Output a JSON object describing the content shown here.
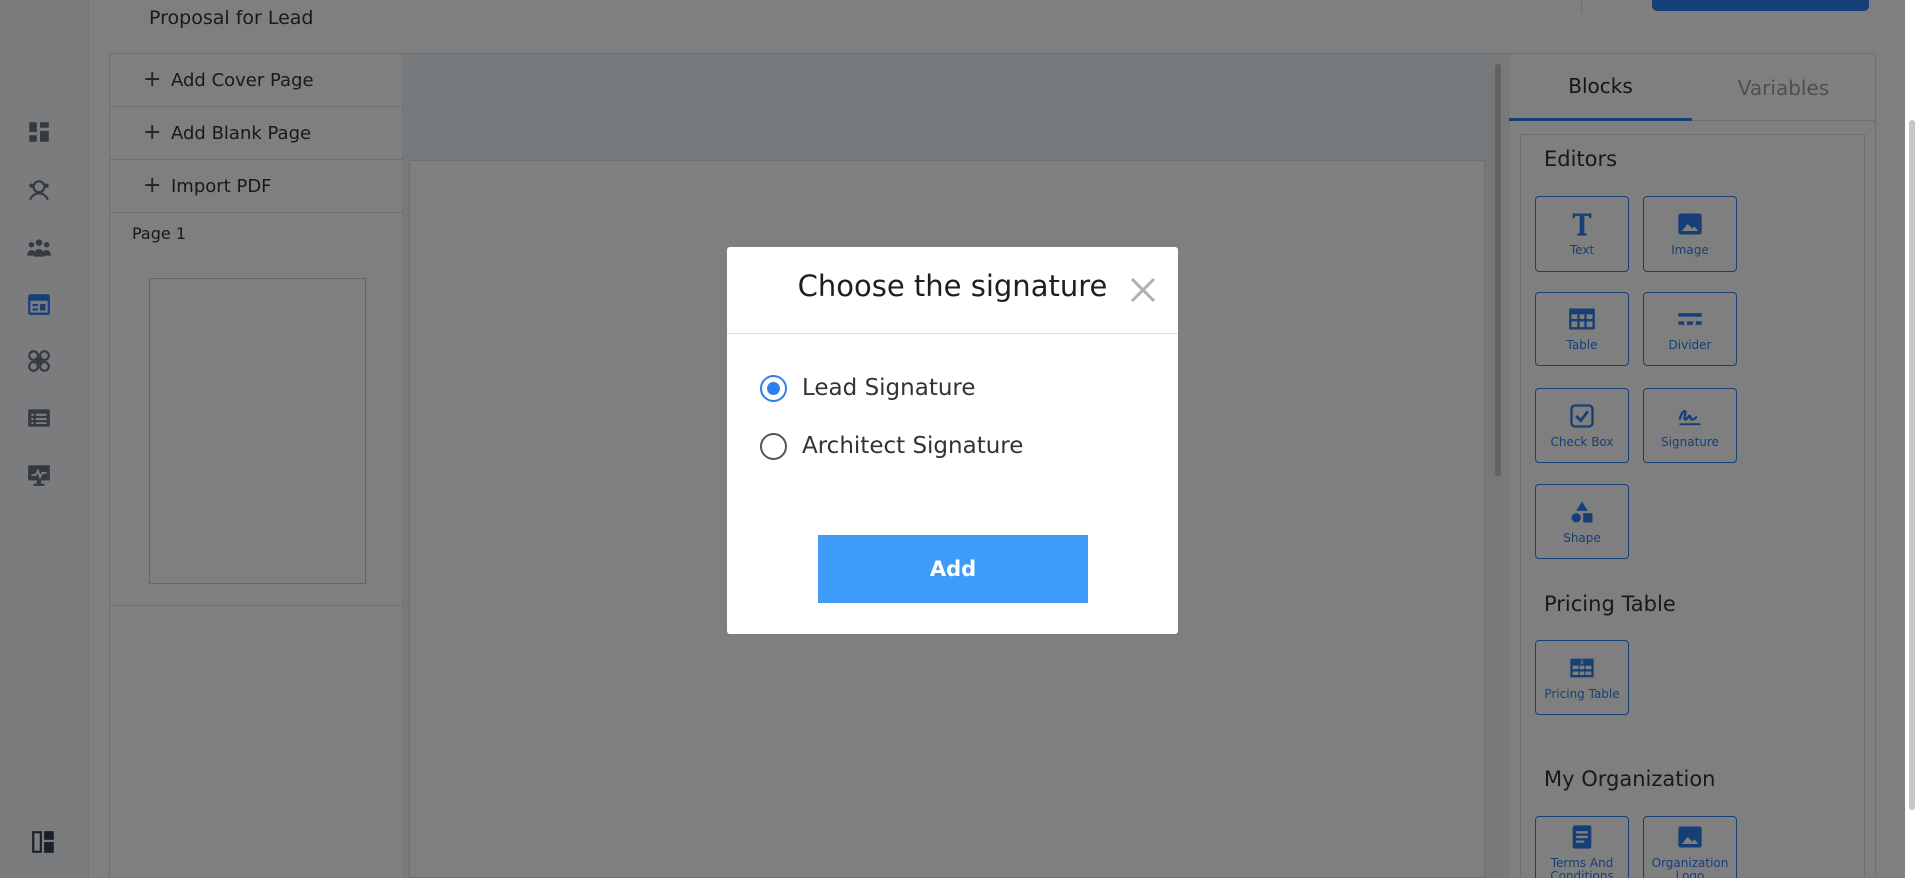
{
  "header": {
    "doc_title": "Proposal for Lead"
  },
  "rail": {
    "icons": [
      "dashboard-icon",
      "leads-icon",
      "team-icon",
      "calendar-icon",
      "projects-icon",
      "list-icon",
      "reports-icon"
    ],
    "bottom_icon": "layout-icon"
  },
  "pages_panel": {
    "actions": [
      {
        "label": "Add Cover Page"
      },
      {
        "label": "Add Blank Page"
      },
      {
        "label": "Import PDF"
      }
    ],
    "page_label": "Page 1"
  },
  "blocks_panel": {
    "tabs": [
      {
        "label": "Blocks",
        "active": true
      },
      {
        "label": "Variables",
        "active": false
      }
    ],
    "editors": {
      "title": "Editors",
      "items": [
        {
          "label": "Text",
          "icon": "text-icon"
        },
        {
          "label": "Image",
          "icon": "image-icon"
        },
        {
          "label": "Table",
          "icon": "table-icon"
        },
        {
          "label": "Divider",
          "icon": "divider-icon"
        },
        {
          "label": "Check Box",
          "icon": "checkbox-icon"
        },
        {
          "label": "Signature",
          "icon": "signature-icon"
        },
        {
          "label": "Shape",
          "icon": "shape-icon"
        }
      ]
    },
    "pricing": {
      "title": "Pricing Table",
      "items": [
        {
          "label": "Pricing Table",
          "icon": "pricing-table-icon"
        }
      ]
    },
    "organization": {
      "title": "My Organization",
      "items": [
        {
          "label": "Terms And Conditions",
          "icon": "document-icon"
        },
        {
          "label": "Organization Logo",
          "icon": "image-icon"
        }
      ]
    }
  },
  "modal": {
    "title": "Choose the signature",
    "options": [
      {
        "label": "Lead Signature",
        "selected": true
      },
      {
        "label": "Architect Signature",
        "selected": false
      }
    ],
    "add_label": "Add"
  },
  "colors": {
    "accent": "#2d7ff0",
    "add_button": "#3f9bf8",
    "overlay": "rgba(0,0,0,0.5)"
  }
}
